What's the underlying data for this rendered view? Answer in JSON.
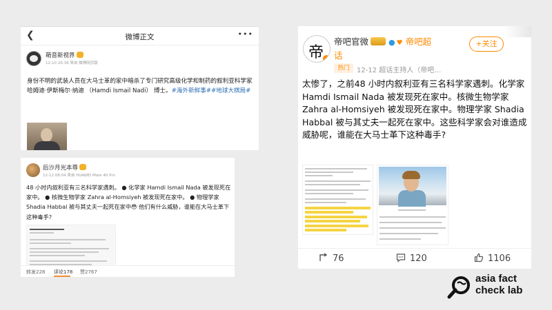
{
  "post1": {
    "nav_title": "微博正文",
    "user_name": "萌音新视界",
    "meta": "12-10 20:39 来自 微博网页版",
    "body": "身份不明的武装人员在大马士革的家中暗杀了专门研究高级化学和制药的叙利亚科学家哈姆迪·伊斯梅尔·纳迪 （Hamdi Ismail Nadi） 博士。",
    "hashtags": "#海外新鲜事##地球大棋局#"
  },
  "post2": {
    "user_name": "后沙月光本尊",
    "meta": "12-12 08:04 来自 HUAWEI Mate 40 Pro",
    "body": "48 小时内叙利亚有三名科学家遇刺。 ● 化学家 Hamdi Ismail Nada 被发现死在家中。 ● 核微生物学家 Zahra al-Homsiyeh 被发现死在家中。 ● 物理学家 Shadia Habbal 被与其丈夫一起死在家中😳 他们有什么威胁，谁能在大马士革下这种毒手?",
    "repost": "转发228",
    "comment": "评论178",
    "like": "赞2767"
  },
  "post3": {
    "user_name": "帝吧官微",
    "super_topic": "帝吧超话",
    "follow_label": "+关注",
    "hot_badge": "热门",
    "meta": "12-12  超话主持人（帝吧…",
    "body": "太惨了，之前48 小时内叙利亚有三名科学家遇刺。化学家 Hamdi Ismail Nada 被发现死在家中。核微生物学家 Zahra al-Homsiyeh 被发现死在家中。物理学家 Shadia Habbal 被与其丈夫一起死在家中。这些科学家会对谁造成威胁呢，谁能在大马士革下这种毒手?",
    "repost_count": "76",
    "comment_count": "120",
    "like_count": "1106"
  },
  "logo": {
    "line1": "asia fact",
    "line2": "check lab"
  },
  "colors": {
    "accent": "#ff8a00",
    "link": "#2c6eb6",
    "background": "#ececec"
  },
  "icons": [
    "chevron-left-icon",
    "more-icon",
    "verified-badge-icon",
    "repost-icon",
    "comment-icon",
    "like-icon",
    "magnifier-logo-icon"
  ]
}
